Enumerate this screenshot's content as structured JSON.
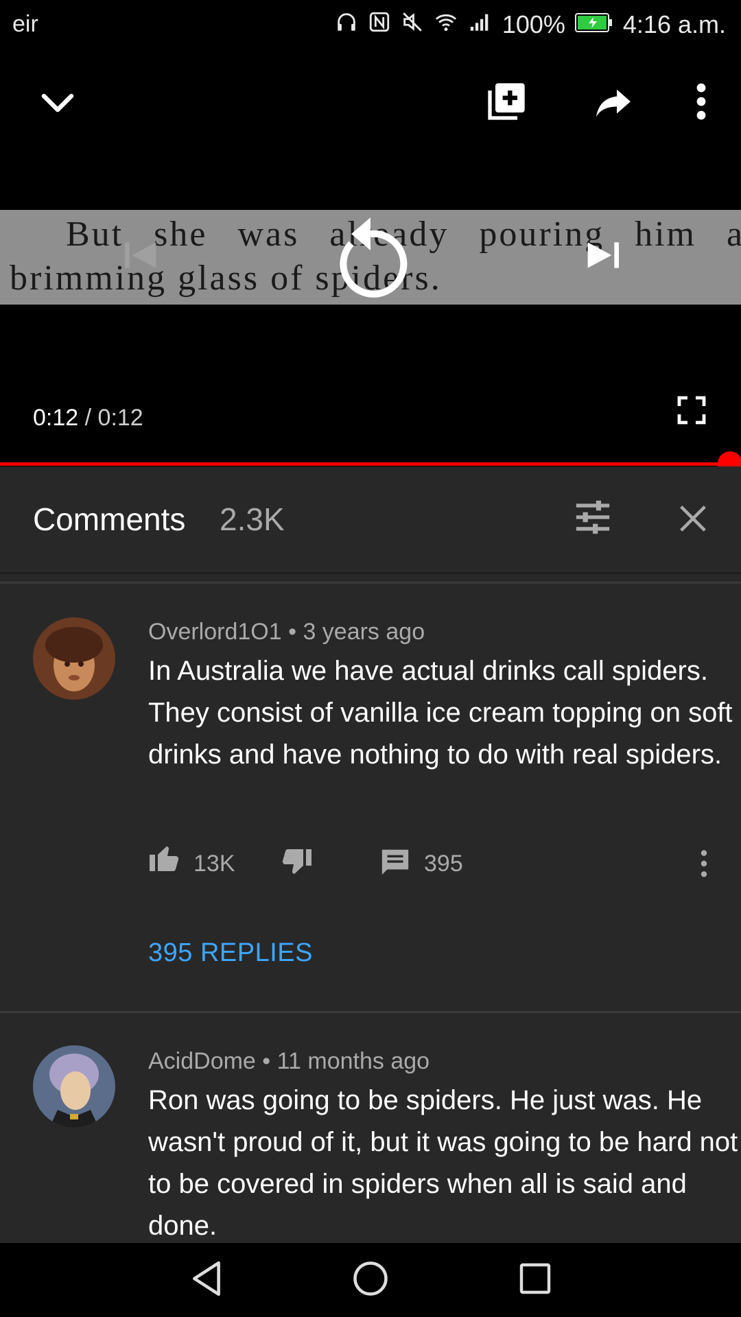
{
  "status_bar": {
    "carrier": "eir",
    "battery": "100%",
    "time": "4:16 a.m."
  },
  "video": {
    "subtitle_line1": "But she was already pouring him a",
    "subtitle_line2": "brimming glass of spiders.",
    "current_time": "0:12",
    "separator": " / ",
    "duration": "0:12",
    "progress": 1.0
  },
  "comments": {
    "title": "Comments",
    "count": "2.3K",
    "items": [
      {
        "author": "Overlord1O1",
        "dot": " • ",
        "age": "3 years ago",
        "text": "In Australia we have actual drinks call spiders. They consist of vanilla ice cream topping on soft drinks and have nothing to do with real spiders.",
        "likes": "13K",
        "reply_count": "395",
        "replies_link": "395 REPLIES"
      },
      {
        "author": "AcidDome",
        "dot": " • ",
        "age": "11 months ago",
        "text": "Ron was going to be spiders. He just was. He wasn't proud of it, but it was going to be hard not to be covered in spiders when all is said and done."
      }
    ]
  },
  "colors": {
    "accent": "#ff0000",
    "link": "#3ea6ff",
    "panel": "#282828"
  }
}
